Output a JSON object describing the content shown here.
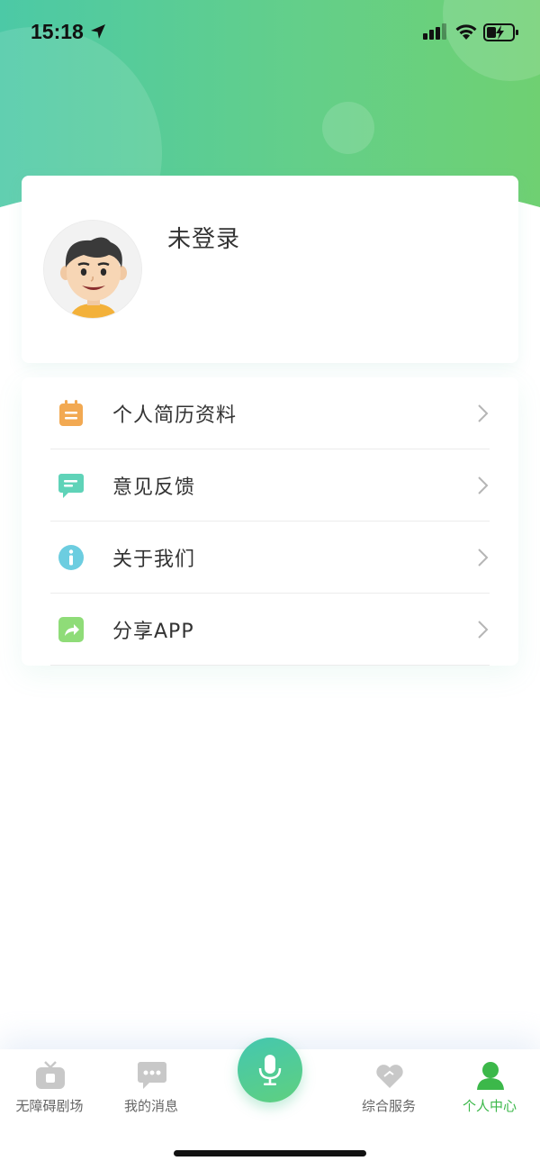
{
  "status_bar": {
    "time": "15:18",
    "icons": [
      "location-arrow-icon",
      "signal-icon",
      "wifi-icon",
      "battery-charging-icon"
    ]
  },
  "profile": {
    "avatar_icon": "cartoon-avatar-icon",
    "login_status": "未登录"
  },
  "menu": {
    "items": [
      {
        "icon": "resume-notebook-icon",
        "label": "个人简历资料",
        "color": "#f2a952"
      },
      {
        "icon": "feedback-chat-icon",
        "label": "意见反馈",
        "color": "#5fd3b8"
      },
      {
        "icon": "info-icon",
        "label": "关于我们",
        "color": "#6ccde0"
      },
      {
        "icon": "share-icon",
        "label": "分享APP",
        "color": "#8fdc78"
      }
    ]
  },
  "tab_bar": {
    "tabs": [
      {
        "icon": "tv-icon",
        "label": "无障碍剧场",
        "active": false
      },
      {
        "icon": "message-bubble-icon",
        "label": "我的消息",
        "active": false
      },
      {
        "icon": "heart-icon",
        "label": "综合服务",
        "active": false
      },
      {
        "icon": "person-icon",
        "label": "个人中心",
        "active": true
      }
    ],
    "voice_button_icon": "microphone-icon"
  },
  "colors": {
    "header_gradient_start": "#4cc9a6",
    "header_gradient_end": "#6fd072",
    "active_tab": "#3cb84a",
    "inactive_tab_icon": "#c8c8c8"
  }
}
